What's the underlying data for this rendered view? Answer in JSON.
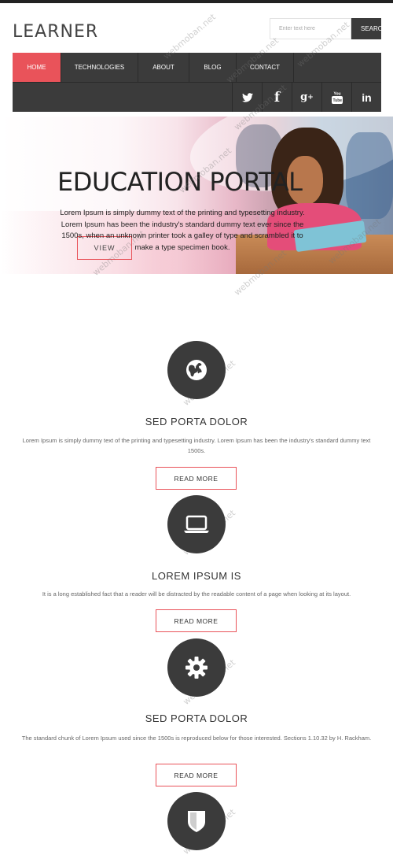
{
  "header": {
    "logo": "LEARNER",
    "search_placeholder": "Enter text here",
    "search_button": "SEARCH"
  },
  "nav": {
    "items": [
      {
        "label": "HOME",
        "active": true
      },
      {
        "label": "TECHNOLOGIES",
        "active": false
      },
      {
        "label": "ABOUT",
        "active": false
      },
      {
        "label": "BLOG",
        "active": false
      },
      {
        "label": "CONTACT",
        "active": false
      }
    ],
    "social": [
      {
        "icon": "twitter-icon",
        "glyph": "🐦"
      },
      {
        "icon": "facebook-icon",
        "glyph": "f"
      },
      {
        "icon": "google-plus-icon",
        "glyph": "g+"
      },
      {
        "icon": "youtube-icon",
        "glyph": "You"
      },
      {
        "icon": "linkedin-icon",
        "glyph": "in"
      }
    ]
  },
  "hero": {
    "title": "EDUCATION PORTAL",
    "text": "Lorem Ipsum is simply dummy text of the printing and typesetting industry. Lorem Ipsum has been the industry's standard dummy text ever since the 1500s, when an unknown printer took a galley of type and scrambled it to make a type specimen book.",
    "button": "VIEW"
  },
  "features": [
    {
      "icon": "globe-icon",
      "title": "SED PORTA DOLOR",
      "description": "Lorem Ipsum is simply dummy text of the printing and typesetting industry. Lorem Ipsum has been the industry's standard dummy text 1500s.",
      "button": "READ MORE"
    },
    {
      "icon": "laptop-icon",
      "title": "LOREM IPSUM IS",
      "description": "It is a long established fact that a reader will be distracted by the readable content of a page when looking at its layout.",
      "button": "READ MORE"
    },
    {
      "icon": "gear-icon",
      "title": "SED PORTA DOLOR",
      "description": "The standard chunk of Lorem Ipsum used since the 1500s is reproduced below for those interested. Sections 1.10.32 by H. Rackham.",
      "button": "READ MORE"
    },
    {
      "icon": "shield-icon"
    }
  ],
  "watermark": "webmoban.net",
  "colors": {
    "accent": "#e9535a",
    "dark": "#3b3b3b"
  }
}
